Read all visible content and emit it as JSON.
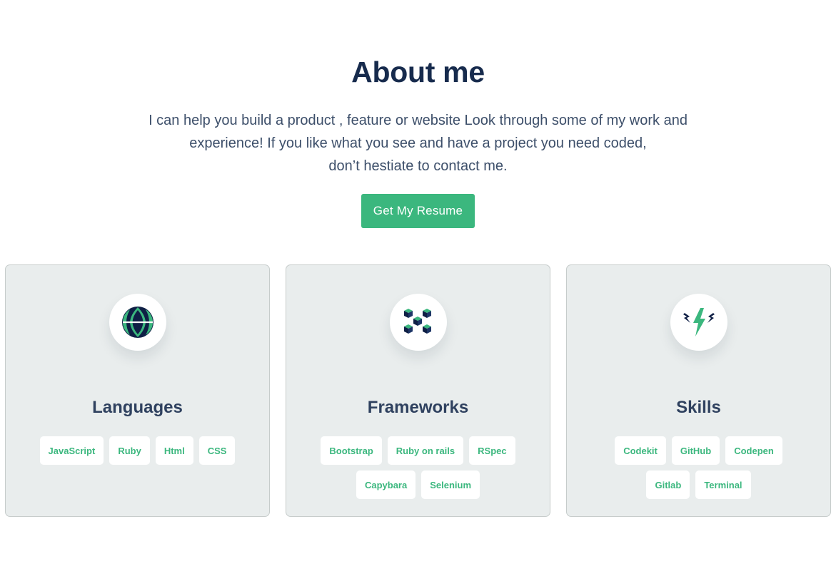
{
  "title": "About me",
  "intro": {
    "line1": "I can help you build a product , feature or website Look through some of my work and",
    "line2": "experience! If you like what you see and have a project you need coded,",
    "line3": "don’t hestiate to contact me."
  },
  "resume_button": "Get My Resume",
  "colors": {
    "accent": "#3bb77e",
    "heading": "#172b4d",
    "card_bg": "#e9eded"
  },
  "cards": [
    {
      "icon": "globe-icon",
      "title": "Languages",
      "tags": [
        "JavaScript",
        "Ruby",
        "Html",
        "CSS"
      ]
    },
    {
      "icon": "cubes-icon",
      "title": "Frameworks",
      "tags": [
        "Bootstrap",
        "Ruby on rails",
        "RSpec",
        "Capybara",
        "Selenium"
      ]
    },
    {
      "icon": "lightning-icon",
      "title": "Skills",
      "tags": [
        "Codekit",
        "GitHub",
        "Codepen",
        "Gitlab",
        "Terminal"
      ]
    }
  ]
}
